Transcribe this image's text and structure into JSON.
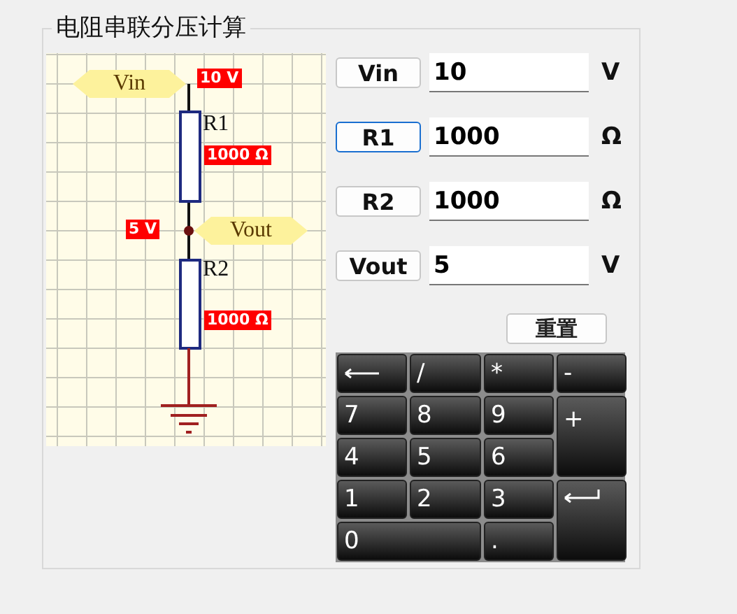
{
  "group_title": "电阻串联分压计算",
  "circuit": {
    "vin_tag": "Vin",
    "vin_reading": "10 V",
    "r1_label": "R1",
    "r1_value": "1000 Ω",
    "node_reading": "5 V",
    "vout_tag": "Vout",
    "r2_label": "R2",
    "r2_value": "1000 Ω"
  },
  "fields": [
    {
      "button": "Vin",
      "value": "10",
      "unit": "V",
      "focused": false
    },
    {
      "button": "R1",
      "value": "1000",
      "unit": "Ω",
      "focused": true
    },
    {
      "button": "R2",
      "value": "1000",
      "unit": "Ω",
      "focused": false
    },
    {
      "button": "Vout",
      "value": "5",
      "unit": "V",
      "focused": false
    }
  ],
  "reset_button": "重置",
  "keys": [
    {
      "kind": "backspace"
    },
    {
      "kind": "text",
      "label": "/"
    },
    {
      "kind": "text",
      "label": "*"
    },
    {
      "kind": "text",
      "label": "-"
    },
    {
      "kind": "text",
      "label": "7"
    },
    {
      "kind": "text",
      "label": "8"
    },
    {
      "kind": "text",
      "label": "9"
    },
    {
      "kind": "text",
      "label": "+",
      "tall": true
    },
    {
      "kind": "text",
      "label": "4"
    },
    {
      "kind": "text",
      "label": "5"
    },
    {
      "kind": "text",
      "label": "6"
    },
    {
      "kind": "text",
      "label": "1"
    },
    {
      "kind": "text",
      "label": "2"
    },
    {
      "kind": "text",
      "label": "3"
    },
    {
      "kind": "enter",
      "tall": true
    },
    {
      "kind": "text",
      "label": "0",
      "wide": true
    },
    {
      "kind": "text",
      "label": "."
    }
  ]
}
